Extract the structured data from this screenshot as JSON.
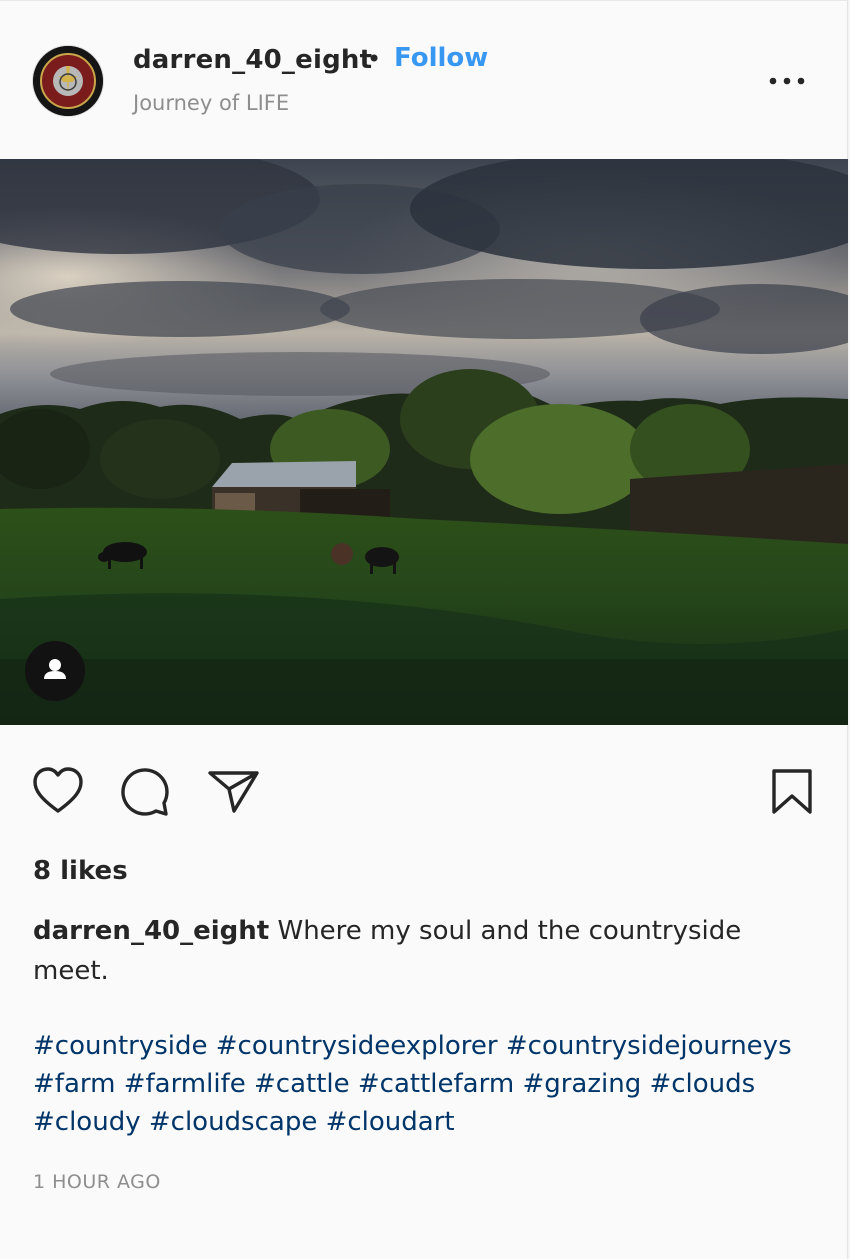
{
  "header": {
    "username": "darren_40_eight",
    "separator": "•",
    "follow_label": "Follow",
    "subtitle": "Journey of LIFE",
    "more_icon": "more-horizontal-icon"
  },
  "avatar": {
    "icon": "marine-corps-emblem"
  },
  "photo": {
    "tag_icon": "user-tag-icon"
  },
  "actions": {
    "like_icon": "heart-icon",
    "comment_icon": "comment-icon",
    "share_icon": "share-icon",
    "save_icon": "bookmark-icon"
  },
  "post": {
    "likes": "8 likes",
    "caption_user": "darren_40_eight",
    "caption_text": "Where my soul and the countryside meet.",
    "hashtags": [
      "#countryside",
      "#countrysideexplorer",
      "#countrysidejourneys",
      "#farm",
      "#farmlife",
      "#cattle",
      "#cattlefarm",
      "#grazing",
      "#clouds",
      "#cloudy",
      "#cloudscape",
      "#cloudart"
    ],
    "timestamp": "1 HOUR AGO"
  },
  "colors": {
    "follow": "#3897f0",
    "hashtag": "#003569",
    "muted": "#8e8e8e"
  }
}
